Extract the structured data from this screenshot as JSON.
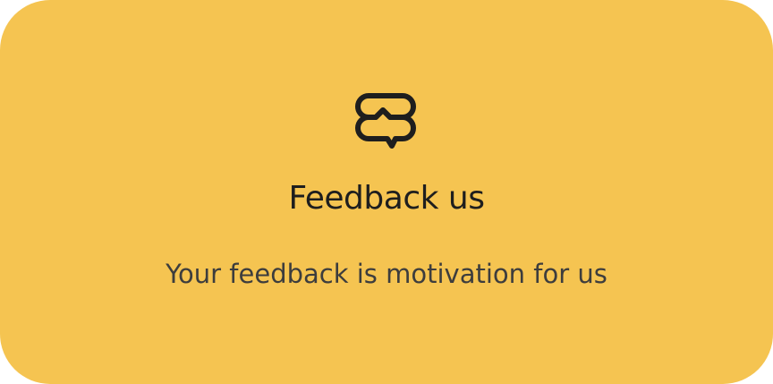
{
  "card": {
    "background_color": "#F5C451",
    "icon": "chat-feedback-icon",
    "icon_color": "#1E1E1E",
    "title": "Feedback us",
    "title_color": "#1E1E1E",
    "subtitle": "Your feedback is motivation for us",
    "subtitle_color": "#3D3D3D"
  }
}
